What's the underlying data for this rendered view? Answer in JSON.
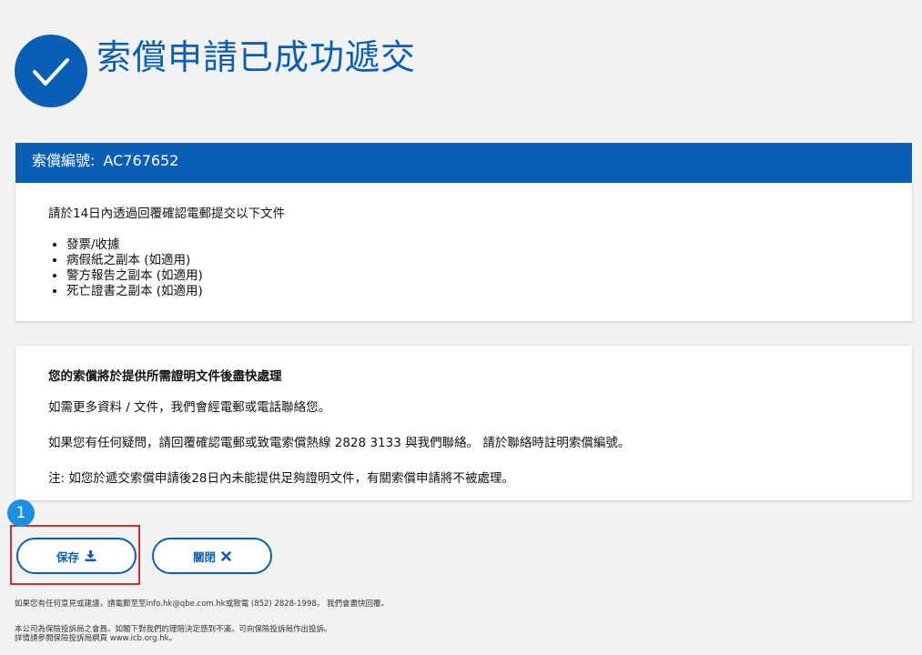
{
  "success": {
    "title": "索償申請已成功遞交"
  },
  "claim": {
    "label": "索償編號:",
    "number": "AC767652"
  },
  "documents": {
    "intro": "請於14日內透過回覆確認電郵提交以下文件",
    "items": [
      "發票/收據",
      "病假紙之副本 (如適用)",
      "警方報告之副本 (如適用)",
      "死亡證書之副本 (如適用)"
    ]
  },
  "processing": {
    "heading": "您的索償將於提供所需證明文件後盡快處理",
    "line1": "如需更多資料 / 文件，我們會經電郵或電話聯絡您。",
    "line2": "如果您有任何疑問，請回覆確認電郵或致電索償熱線 2828 3133 與我們聯絡。 請於聯絡時註明索償編號。",
    "line3": "注: 如您於遞交索償申請後28日內未能提供足夠證明文件，有關索償申請將不被處理。"
  },
  "annotation": {
    "step": "1"
  },
  "buttons": {
    "save": "保存",
    "close": "關閉"
  },
  "footer": {
    "line1": "如果您有任何意見或建議，請電郵至至info.hk@qbe.com.hk或致電 (852) 2828-1998。 我們會盡快回覆。",
    "line2": "本公司為保險投訴局之會員。如閣下對我們的理賠決定感到不滿，可向保險投訴局作出投訴。",
    "line3": "詳情請參閱保險投訴局網頁 www.icb.org.hk。"
  },
  "colors": {
    "brand": "#0a5fb4",
    "badge": "#1a8fe3",
    "highlight": "#e3262b"
  }
}
